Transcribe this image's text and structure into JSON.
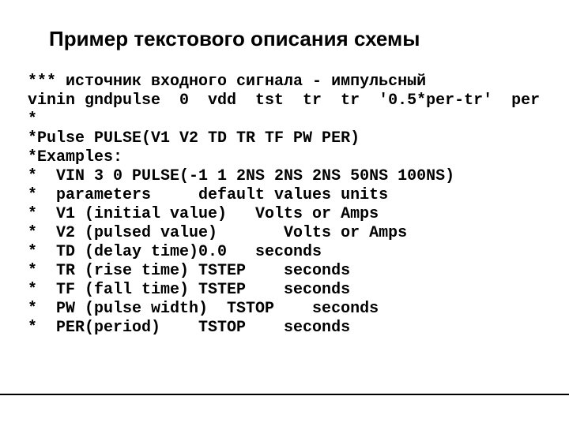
{
  "slide": {
    "title": "Пример текстового описания схемы",
    "code_lines": [
      "*** источник входного сигнала - импульсный",
      "vinin gndpulse  0  vdd  tst  tr  tr  '0.5*per-tr'  per",
      "*",
      "*Pulse PULSE(V1 V2 TD TR TF PW PER)",
      "*Examples:",
      "*  VIN 3 0 PULSE(-1 1 2NS 2NS 2NS 50NS 100NS)",
      "*  parameters     default values units",
      "*  V1 (initial value)   Volts or Amps",
      "*  V2 (pulsed value)       Volts or Amps",
      "*  TD (delay time)0.0   seconds",
      "*  TR (rise time) TSTEP    seconds",
      "*  TF (fall time) TSTEP    seconds",
      "*  PW (pulse width)  TSTOP    seconds",
      "*  PER(period)    TSTOP    seconds"
    ]
  }
}
